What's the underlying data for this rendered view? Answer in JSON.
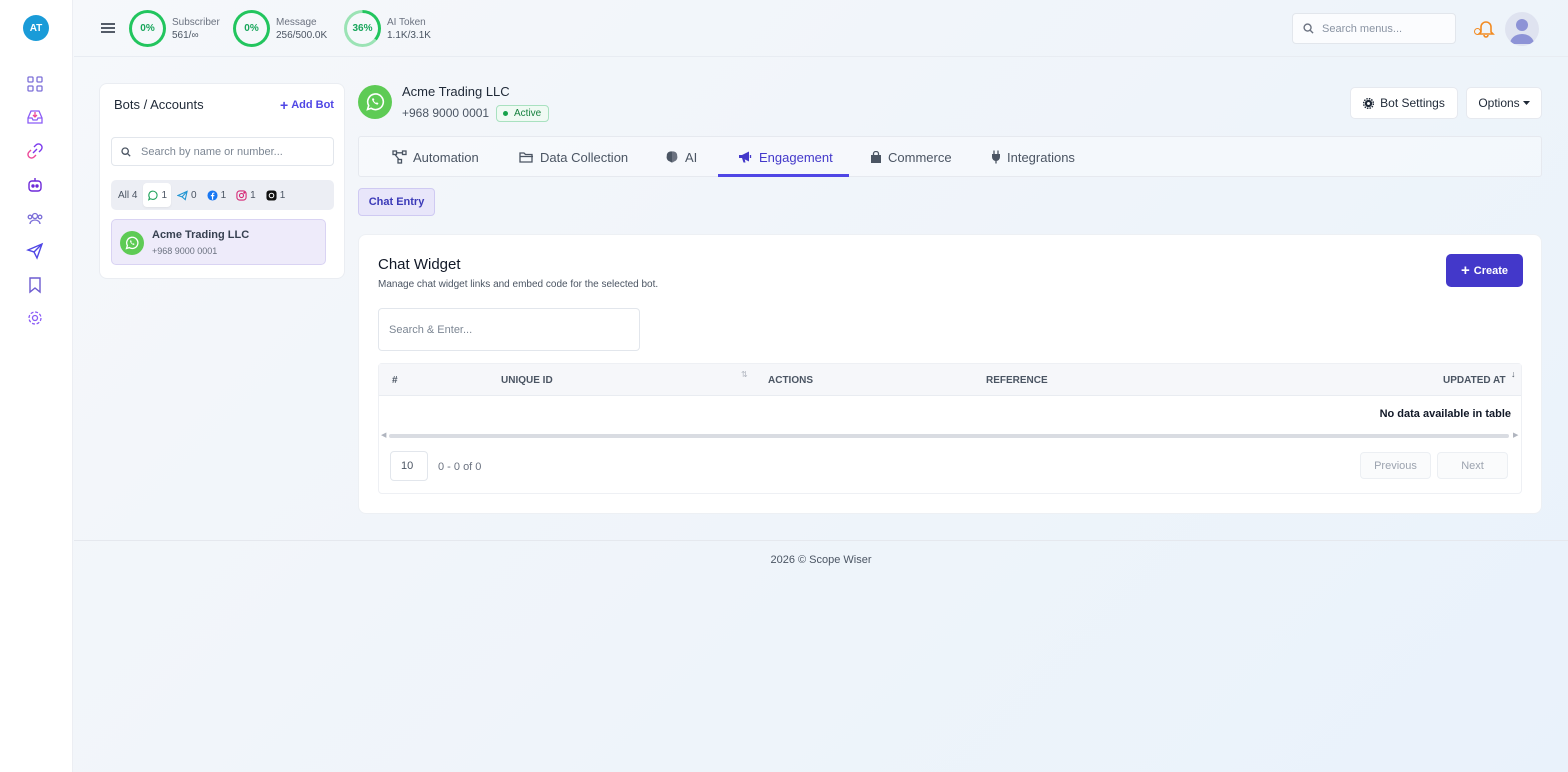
{
  "rail": {
    "avatar_initials": "AT",
    "icons": [
      "dashboard-icon",
      "inbox-icon",
      "link-icon",
      "bot-icon",
      "contacts-icon",
      "send-icon",
      "bookmark-icon",
      "settings-icon"
    ]
  },
  "topbar": {
    "stats": [
      {
        "percent": "0%",
        "label": "Subscriber",
        "value": "561/∞",
        "fill": 0
      },
      {
        "percent": "0%",
        "label": "Message",
        "value": "256/500.0K",
        "fill": 0
      },
      {
        "percent": "36%",
        "label": "AI Token",
        "value": "1.1K/3.1K",
        "fill": 0.36
      }
    ],
    "search_placeholder": "Search menus..."
  },
  "bots_panel": {
    "title": "Bots / Accounts",
    "add_label": "Add Bot",
    "search_placeholder": "Search by name or number...",
    "filters": [
      {
        "label": "All 4"
      },
      {
        "icon": "whatsapp-icon",
        "count": "1"
      },
      {
        "icon": "telegram-icon",
        "count": "0"
      },
      {
        "icon": "facebook-icon",
        "count": "1"
      },
      {
        "icon": "instagram-icon",
        "count": "1"
      },
      {
        "icon": "threads-icon",
        "count": "1"
      }
    ],
    "items": [
      {
        "name": "Acme Trading LLC",
        "number": "+968 9000 0001"
      }
    ]
  },
  "bot_header": {
    "name": "Acme Trading LLC",
    "number": "+968 9000 0001",
    "status": "Active",
    "settings_label": "Bot Settings",
    "options_label": "Options"
  },
  "tabs": [
    {
      "label": "Automation",
      "icon": "automation-icon"
    },
    {
      "label": "Data Collection",
      "icon": "folder-icon"
    },
    {
      "label": "AI",
      "icon": "brain-icon"
    },
    {
      "label": "Engagement",
      "icon": "megaphone-icon",
      "active": true
    },
    {
      "label": "Commerce",
      "icon": "bag-icon"
    },
    {
      "label": "Integrations",
      "icon": "plug-icon"
    }
  ],
  "subtab": "Chat Entry",
  "card": {
    "title": "Chat Widget",
    "subtitle": "Manage chat widget links and embed code for the selected bot.",
    "create_label": "Create",
    "search_placeholder": "Search & Enter...",
    "columns": [
      "#",
      "UNIQUE ID",
      "ACTIONS",
      "REFERENCE",
      "UPDATED AT"
    ],
    "empty_text": "No data available in table",
    "page_size": "10",
    "page_info": "0 - 0 of 0",
    "prev_label": "Previous",
    "next_label": "Next"
  },
  "footer": "2026 © Scope Wiser",
  "colors": {
    "accent": "#4338ca",
    "ring_green": "#22c55e",
    "whatsapp": "#5ecb55",
    "rail_avatar": "#1a9bd8"
  }
}
